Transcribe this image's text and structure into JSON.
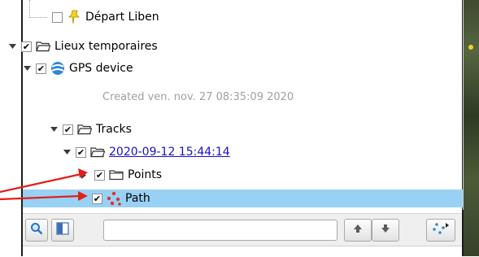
{
  "tree": {
    "items": [
      {
        "label": "Départ Liben",
        "checked": false,
        "icon": "pushpin-icon"
      },
      {
        "label": "Lieux temporaires",
        "checked": true,
        "icon": "folder-open-icon"
      },
      {
        "label": "GPS device",
        "checked": true,
        "icon": "gps-device-icon"
      },
      {
        "label": "Created ven. nov. 27 08:35:09 2020"
      },
      {
        "label": "Tracks",
        "checked": true,
        "icon": "folder-open-icon"
      },
      {
        "label": "2020-09-12 15:44:14",
        "checked": true,
        "icon": "folder-open-icon"
      },
      {
        "label": "Points",
        "checked": true,
        "icon": "folder-closed-icon"
      },
      {
        "label": "Path",
        "checked": true,
        "icon": "path-icon",
        "selected": true
      }
    ]
  },
  "toolbar": {
    "search_value": "",
    "search_placeholder": ""
  },
  "colors": {
    "selection": "#99d1f5",
    "link": "#1a10c8",
    "annotation_arrow": "#e0201b"
  }
}
